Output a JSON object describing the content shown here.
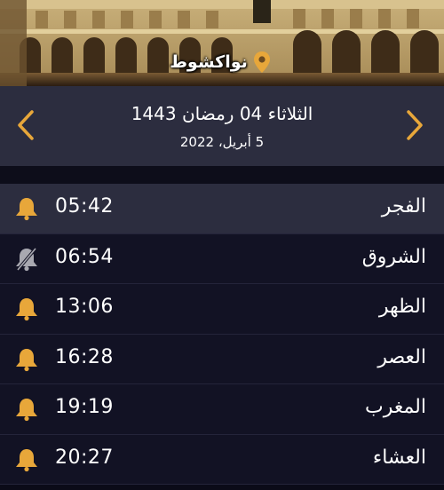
{
  "location": {
    "name": "نواكشوط",
    "pin_icon": "map-pin-icon",
    "pin_color": "#e8a73a"
  },
  "date": {
    "hijri": "الثلاثاء 04 رمضان 1443",
    "gregorian": "5 أبريل، 2022",
    "prev_icon": "chevron-left-icon",
    "next_icon": "chevron-right-icon"
  },
  "colors": {
    "accent": "#e8a73a",
    "header_bg": "#2c2d3f",
    "list_bg": "#121224",
    "muted_icon": "#a8a8b0"
  },
  "prayers": [
    {
      "name": "الفجر",
      "time": "05:42",
      "alert": "on",
      "current": true
    },
    {
      "name": "الشروق",
      "time": "06:54",
      "alert": "off",
      "current": false
    },
    {
      "name": "الظهر",
      "time": "13:06",
      "alert": "on",
      "current": false
    },
    {
      "name": "العصر",
      "time": "16:28",
      "alert": "on",
      "current": false
    },
    {
      "name": "المغرب",
      "time": "19:19",
      "alert": "on",
      "current": false
    },
    {
      "name": "العشاء",
      "time": "20:27",
      "alert": "on",
      "current": false
    }
  ]
}
